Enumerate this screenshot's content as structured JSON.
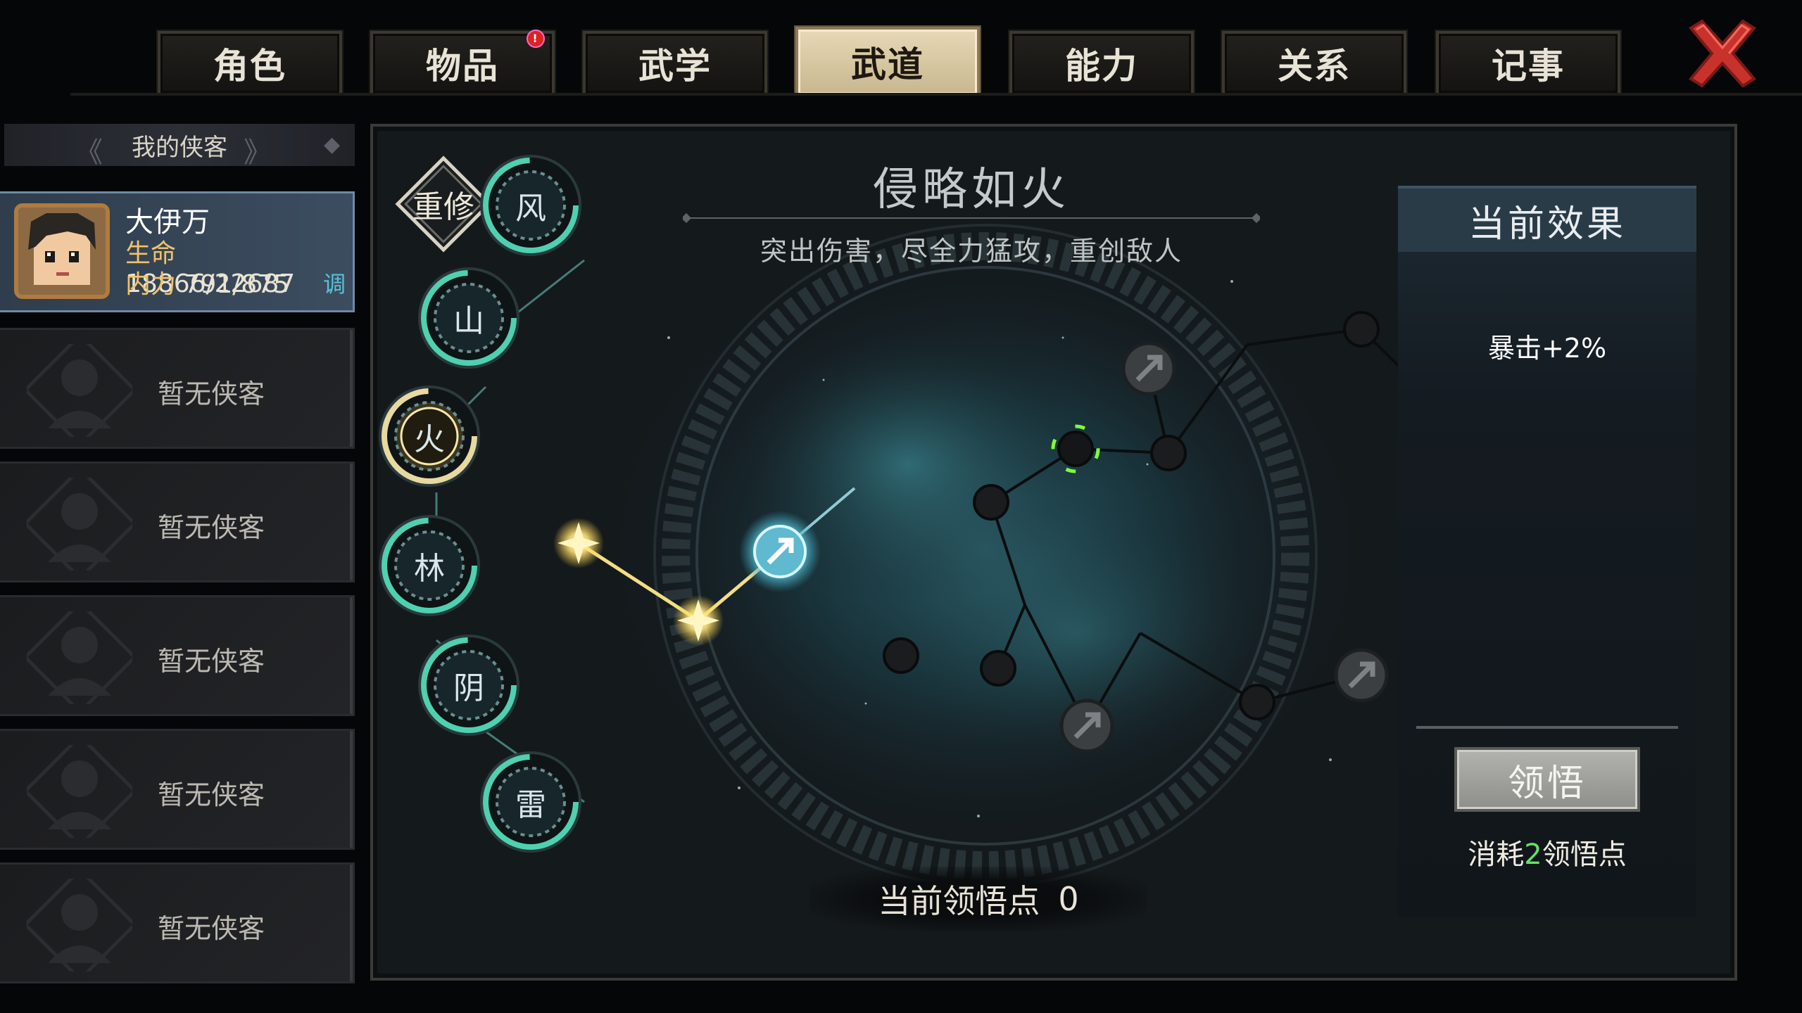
{
  "tabs": [
    {
      "label": "角色",
      "active": false,
      "badge": false
    },
    {
      "label": "物品",
      "active": false,
      "badge": true
    },
    {
      "label": "武学",
      "active": false,
      "badge": false
    },
    {
      "label": "武道",
      "active": true,
      "badge": false
    },
    {
      "label": "能力",
      "active": false,
      "badge": false
    },
    {
      "label": "关系",
      "active": false,
      "badge": false
    },
    {
      "label": "记事",
      "active": false,
      "badge": false
    }
  ],
  "roster": {
    "header": "我的侠客",
    "hero": {
      "name": "大伊万",
      "hp_label": "生命",
      "hp_value": "18866/22687",
      "mp_label": "内力",
      "mp_value": "791/875",
      "adjust_label": "调"
    },
    "empty_label": "暂无侠客",
    "empty_slots": 5
  },
  "path": {
    "title": "侵略如火",
    "description": "突出伤害，尽全力猛攻，重创敌人",
    "reset_label": "重修",
    "branches": [
      "风",
      "山",
      "火",
      "林",
      "阴",
      "雷"
    ],
    "active_branch": "火",
    "points_label": "当前领悟点",
    "points_value": "0"
  },
  "effect": {
    "header": "当前效果",
    "items": [
      "暴击+2%"
    ],
    "button_label": "领悟",
    "cost_prefix": "消耗",
    "cost_value": "2",
    "cost_suffix": "领悟点"
  },
  "colors": {
    "active_tab": "#d9c9a2",
    "accent_teal": "#4fd0b0",
    "gold_glow": "#fff0a0",
    "close_red": "#d23a34",
    "cost_green": "#63e26a"
  }
}
